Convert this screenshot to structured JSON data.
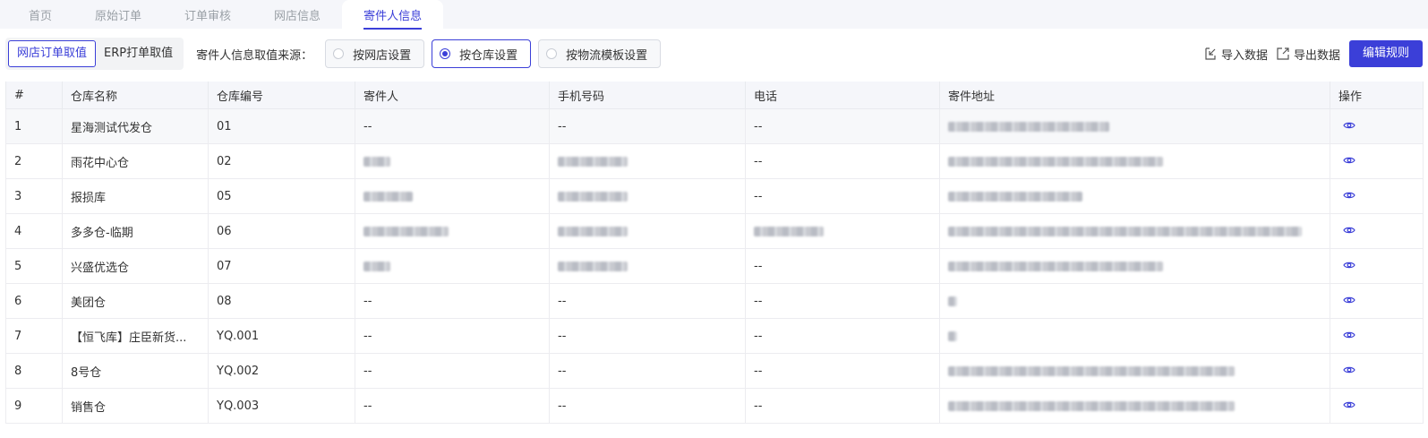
{
  "tabs": [
    {
      "label": "首页",
      "active": false
    },
    {
      "label": "原始订单",
      "active": false
    },
    {
      "label": "订单审核",
      "active": false
    },
    {
      "label": "网店信息",
      "active": false
    },
    {
      "label": "寄件人信息",
      "active": true
    }
  ],
  "toolbar": {
    "segment": [
      {
        "label": "网店订单取值",
        "active": true
      },
      {
        "label": "ERP打单取值",
        "active": false
      }
    ],
    "source_label": "寄件人信息取值来源：",
    "radios": [
      {
        "label": "按网店设置",
        "checked": false
      },
      {
        "label": "按仓库设置",
        "checked": true
      },
      {
        "label": "按物流模板设置",
        "checked": false
      }
    ],
    "import_label": "导入数据",
    "export_label": "导出数据",
    "edit_rules_label": "编辑规则"
  },
  "table": {
    "headers": [
      "#",
      "仓库名称",
      "仓库编号",
      "寄件人",
      "手机号码",
      "电话",
      "寄件地址",
      "操作"
    ],
    "rows": [
      {
        "index": "1",
        "name": "星海测试代发仓",
        "code": "01",
        "sender": "--",
        "mobile": "--",
        "phone": "--",
        "address": ""
      },
      {
        "index": "2",
        "name": "雨花中心仓",
        "code": "02",
        "sender": "",
        "mobile": "",
        "phone": "--",
        "address": ""
      },
      {
        "index": "3",
        "name": "报损库",
        "code": "05",
        "sender": "",
        "mobile": "",
        "phone": "--",
        "address": ""
      },
      {
        "index": "4",
        "name": "多多仓-临期",
        "code": "06",
        "sender": "",
        "mobile": "",
        "phone": "",
        "address": ""
      },
      {
        "index": "5",
        "name": "兴盛优选仓",
        "code": "07",
        "sender": "",
        "mobile": "",
        "phone": "--",
        "address": ""
      },
      {
        "index": "6",
        "name": "美团仓",
        "code": "08",
        "sender": "--",
        "mobile": "--",
        "phone": "--",
        "address": ""
      },
      {
        "index": "7",
        "name": "【恒飞库】庄臣新货...",
        "code": "YQ.001",
        "sender": "--",
        "mobile": "--",
        "phone": "--",
        "address": ""
      },
      {
        "index": "8",
        "name": "8号仓",
        "code": "YQ.002",
        "sender": "--",
        "mobile": "--",
        "phone": "--",
        "address": ""
      },
      {
        "index": "9",
        "name": "销售仓",
        "code": "YQ.003",
        "sender": "--",
        "mobile": "--",
        "phone": "--",
        "address": ""
      }
    ],
    "action_icon": "eye-icon"
  },
  "colors": {
    "accent": "#3b3fd8",
    "header_bg": "#f5f6fa"
  }
}
